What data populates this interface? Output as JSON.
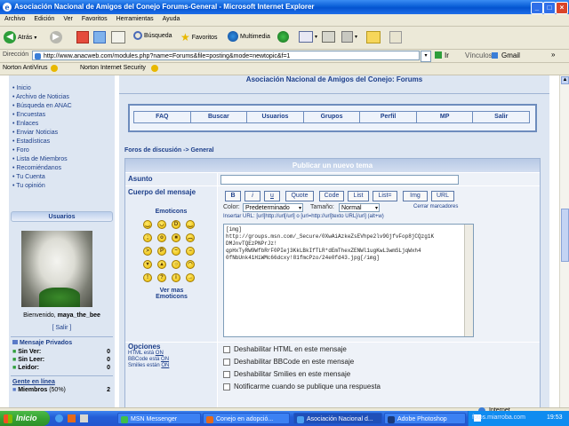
{
  "window": {
    "title": "Asociación Nacional de Amigos del Conejo Forums-General - Microsoft Internet Explorer",
    "controls": [
      "_",
      "□",
      "×"
    ]
  },
  "menu": [
    "Archivo",
    "Edición",
    "Ver",
    "Favoritos",
    "Herramientas",
    "Ayuda"
  ],
  "toolbar": {
    "back": "Atrás",
    "search": "Búsqueda",
    "favorites": "Favoritos",
    "multimedia": "Multimedia"
  },
  "address": {
    "label": "Dirección",
    "url": "http://www.anacweb.com/modules.php?name=Forums&file=posting&mode=newtopic&f=1",
    "go": "Ir",
    "links": "Vínculos",
    "gmail": "Gmail"
  },
  "norton": {
    "antivirus": "Norton AntiVirus",
    "security": "Norton Internet Security"
  },
  "sidebar": {
    "items": [
      "Inicio",
      "Archivo de Noticias",
      "Búsqueda en ANAC",
      "Encuestas",
      "Enlaces",
      "Enviar Noticias",
      "Estadísticas",
      "Foro",
      "Lista de Miembros",
      "Recomiéndanos",
      "Tu Cuenta",
      "Tu opinión"
    ],
    "users_title": "Usuarios",
    "welcome_prefix": "Bienvenido,",
    "username": "maya_the_bee",
    "logout": "[ Salir ]",
    "pm_title": "Mensaje Privados",
    "pm_rows": [
      {
        "label": "Sin Ver:",
        "value": "0"
      },
      {
        "label": "Sin Leer:",
        "value": "0"
      },
      {
        "label": "Leidor:",
        "value": "0"
      }
    ],
    "online_title": "Gente en línea",
    "members_label": "Miembros",
    "members_pct": "(50%)",
    "members_value": "2"
  },
  "main": {
    "heading": "Asociación Nacional de Amigos del Conejo: Forums",
    "nav": [
      "FAQ",
      "Buscar",
      "Usuarios",
      "Grupos",
      "Perfil",
      "MP",
      "Salir"
    ],
    "breadcrumb": "Foros de discusión -> General",
    "form_title": "Publicar un nuevo tema",
    "subject_label": "Asunto",
    "body_label": "Cuerpo del mensaje",
    "emoticons_title": "Emoticons",
    "more_emoticons": "Ver mas Emoticons",
    "bbcode_buttons": [
      "B",
      "i",
      "u",
      "Quote",
      "Code",
      "List",
      "List=",
      "Img",
      "URL"
    ],
    "color_label": "Color:",
    "color_value": "Predeterminado",
    "size_label": "Tamaño:",
    "size_value": "Normal",
    "close_tags": "Cerrar marcadores",
    "url_hint": "Insertar URL: [url]http://url[/url] o [url=http://url]texto URL[/url]  (alt+w)",
    "message_lines": [
      "[img]",
      "http://groups.msn.com/_Secure/0XwAiAzkeZsEVhpe2lv9GjfvFop8jCQzg1K",
      "DMJnvTQEzPNPrJz!",
      "qpHxTyRW9WfbRrF0PIej3KkLBkIfTLR*dEmThexZENWl1ugKwL3wmSLjqWxh4",
      "0fNbUnk41HiWMc66dcxy!81fmcPzo/24e0fd43.jpg[/img]"
    ],
    "options_title": "Opciones",
    "options_status": [
      {
        "label": "HTML está",
        "state": "ON"
      },
      {
        "label": "BBCode está",
        "state": "ON"
      },
      {
        "label": "Smilies están",
        "state": "ON"
      }
    ],
    "options": [
      "Deshabilitar HTML en este mensaje",
      "Deshabilitar BBCode en este mensaje",
      "Deshabilitar Smilies en este mensaje",
      "Notificarme cuando se publique una respuesta"
    ]
  },
  "status": {
    "zone": "Internet"
  },
  "taskbar": {
    "start": "Inicio",
    "tasks": [
      "MSN Messenger",
      "Conejo en adopció...",
      "Asociación Nacional d...",
      "Adobe Photoshop"
    ],
    "time": "19:53",
    "watermark": "fotos.miarroba.com"
  },
  "colors": {
    "accent": "#1d3f8a",
    "panel": "#dde6f2",
    "taskbar": "#245ed6",
    "start": "#36a332"
  }
}
